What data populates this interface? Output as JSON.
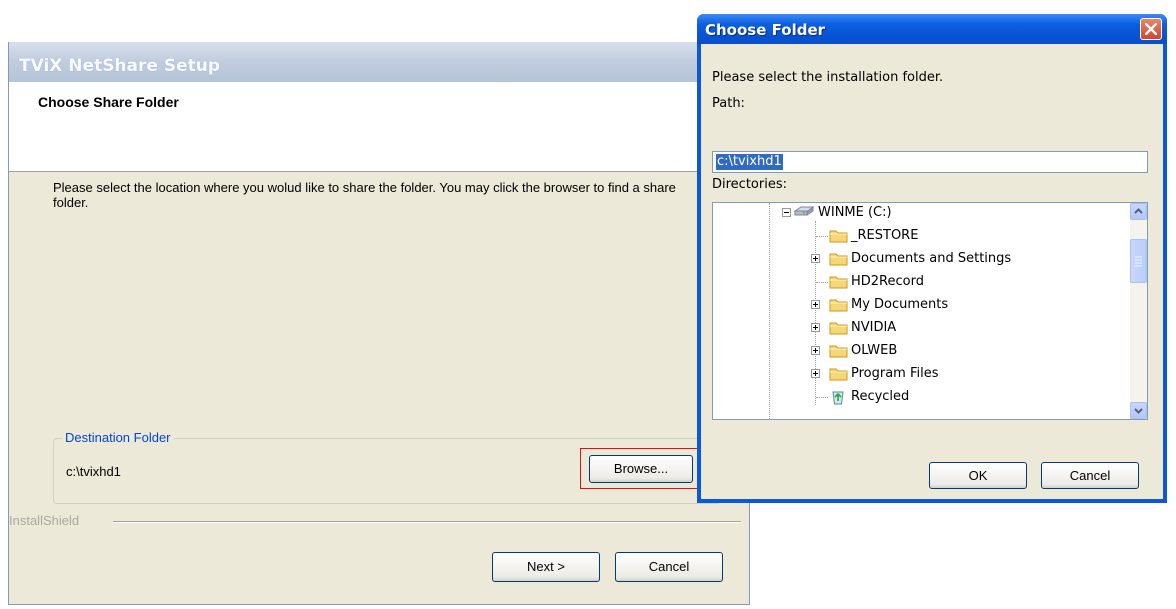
{
  "setup": {
    "window_title": "TViX NetShare Setup",
    "header_title": "Choose Share Folder",
    "description": "Please select the location where you wolud like to share the folder. You may click the browser to find a share folder.",
    "group_label": "Destination Folder",
    "destination_path": "c:\\tvixhd1",
    "browse_label": "Browse...",
    "brand": "InstallShield",
    "next_label": "Next >",
    "cancel_label": "Cancel"
  },
  "dialog": {
    "title": "Choose Folder",
    "prompt": "Please select the installation folder.",
    "path_label": "Path:",
    "path_value": "c:\\tvixhd1",
    "directories_label": "Directories:",
    "tree": [
      {
        "label": "WINME (C:)",
        "icon": "drive-icon",
        "expander": "minus"
      },
      {
        "label": "_RESTORE",
        "icon": "folder-icon",
        "expander": "none"
      },
      {
        "label": "Documents and Settings",
        "icon": "folder-icon",
        "expander": "plus"
      },
      {
        "label": "HD2Record",
        "icon": "folder-icon",
        "expander": "none"
      },
      {
        "label": "My Documents",
        "icon": "folder-icon",
        "expander": "plus"
      },
      {
        "label": "NVIDIA",
        "icon": "folder-icon",
        "expander": "plus"
      },
      {
        "label": "OLWEB",
        "icon": "folder-icon",
        "expander": "plus"
      },
      {
        "label": "Program Files",
        "icon": "folder-icon",
        "expander": "plus"
      },
      {
        "label": "Recycled",
        "icon": "recycle-icon",
        "expander": "none"
      }
    ],
    "ok_label": "OK",
    "cancel_label": "Cancel"
  },
  "colors": {
    "xp_blue": "#0a59d9",
    "dialog_face": "#ece9d8",
    "highlight_red": "#e01010",
    "group_label": "#0046d5"
  }
}
